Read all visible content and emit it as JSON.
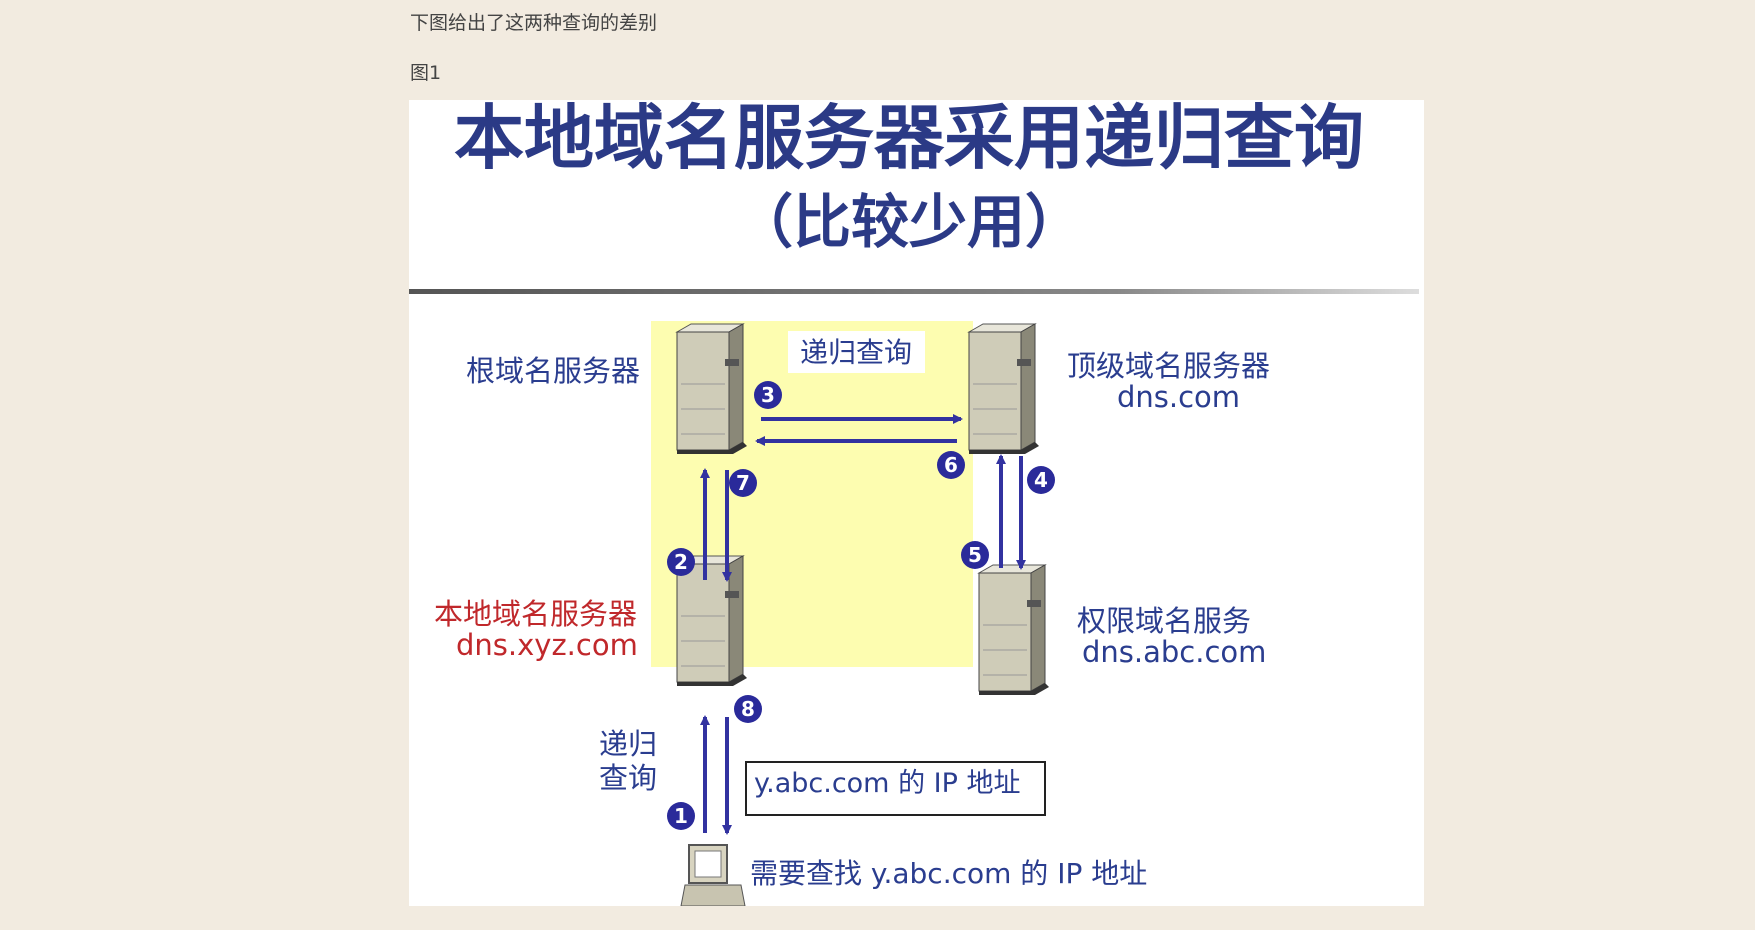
{
  "intro_text": "下图给出了这两种查询的差别",
  "figure_label": "图1",
  "diagram": {
    "title_line1": "本地域名服务器采用递归查询",
    "title_line2": "（比较少用）",
    "center_label": "递归查询",
    "root_server": {
      "label": "根域名服务器"
    },
    "tld_server": {
      "label": "顶级域名服务器",
      "domain": "dns.com"
    },
    "local_server": {
      "label": "本地域名服务器",
      "domain": "dns.xyz.com"
    },
    "auth_server": {
      "label": "权限域名服务",
      "domain": "dns.abc.com"
    },
    "client_query_label_line1": "递归",
    "client_query_label_line2": "查询",
    "answer_box": "y.abc.com 的 IP 地址",
    "client_label": "需要查找 y.abc.com 的 IP 地址",
    "steps": [
      "1",
      "2",
      "3",
      "4",
      "5",
      "6",
      "7",
      "8"
    ],
    "colors": {
      "title": "#2b3a86",
      "label": "#2a3d8f",
      "local_label": "#c0282b",
      "arrow": "#3232a0",
      "highlight": "#fdfdb0",
      "step_circle": "#2a2a9a"
    }
  }
}
